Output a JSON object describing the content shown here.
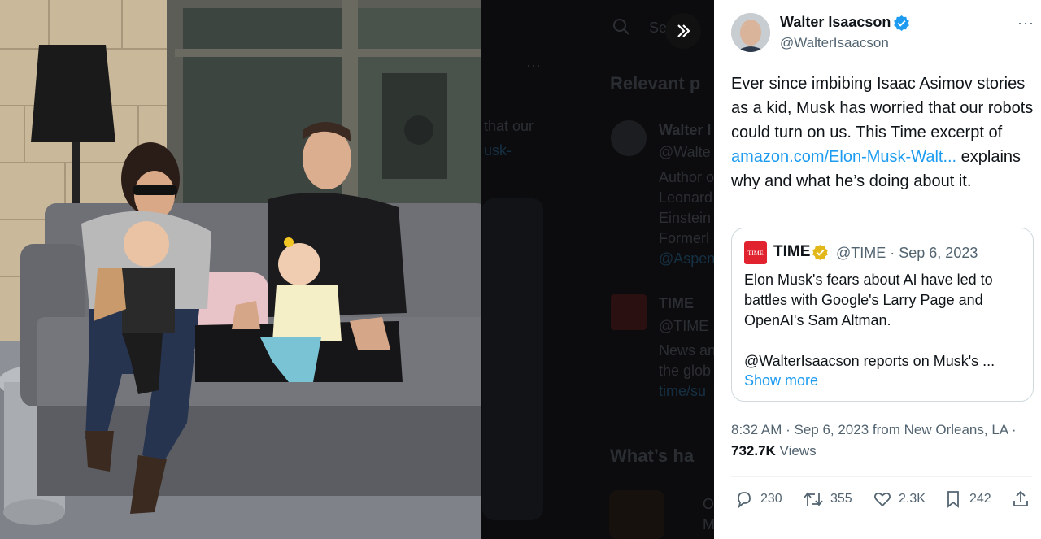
{
  "tweet": {
    "author_name": "Walter Isaacson",
    "author_handle": "@WalterIsaacson",
    "more_label": "···",
    "text_part1": "Ever since imbibing Isaac Asimov stories as a kid, Musk has worried that our robots could turn on us.  This Time excerpt of ",
    "link_text": "amazon.com/Elon-Musk-Walt...",
    "text_part2": " explains why and what he’s doing about it.",
    "timestamp": "8:32 AM · Sep 6, 2023 from New Orleans, LA · ",
    "views_count": "732.7K",
    "views_label": " Views"
  },
  "quoted": {
    "logo_text": "TIME",
    "name": "TIME",
    "meta": "@TIME · Sep 6, 2023",
    "body": "Elon Musk's fears about AI have led to battles with Google's Larry Page and OpenAI's Sam Altman.",
    "body2": "@WalterIsaacson reports on Musk's ...",
    "show_more": "Show more"
  },
  "actions": {
    "replies": "230",
    "reposts": "355",
    "likes": "2.3K",
    "bookmarks": "242"
  },
  "backdrop": {
    "search_placeholder": "Se",
    "relevant_heading": "Relevant p",
    "snippet1": "that our",
    "snippet2": "usk-",
    "author1_name": "Walter I",
    "author1_handle": "@Walte",
    "author1_bio1": "Author o",
    "author1_bio2": "Leonard",
    "author1_bio3": "Einstein",
    "author1_bio4": "Formerl",
    "author1_link": "@Aspen",
    "author2_name": "TIME",
    "author2_handle": "@TIME",
    "author2_bio1": "News an",
    "author2_bio2": "the glob",
    "author2_link": "time/su",
    "whats_heading": "What’s ha",
    "trend_initial": "O",
    "trend_sub": "M"
  },
  "colors": {
    "accent": "#1d9bf0",
    "time_red": "#e0232e",
    "verified_gold": "#e2b719"
  }
}
